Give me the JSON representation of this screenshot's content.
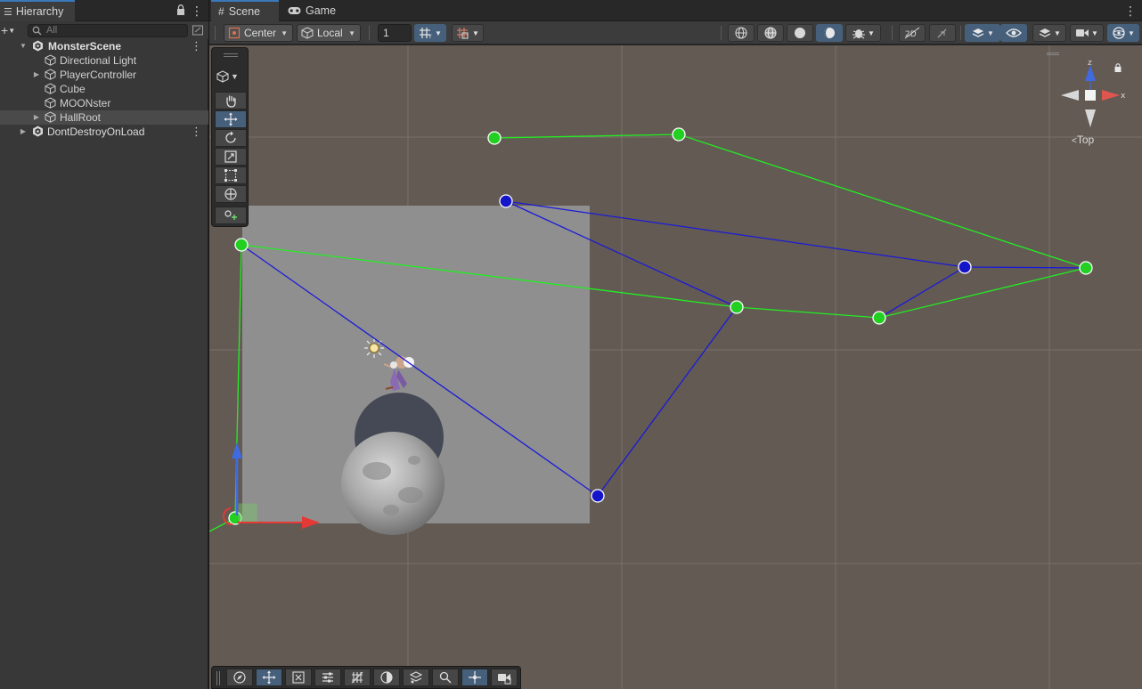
{
  "hierarchy": {
    "tab_label": "Hierarchy",
    "search_placeholder": "All",
    "items": [
      {
        "label": "MonsterScene",
        "kind": "scene",
        "expanded": true
      },
      {
        "label": "Directional Light",
        "kind": "gameobject"
      },
      {
        "label": "PlayerController",
        "kind": "gameobject",
        "has_children": true
      },
      {
        "label": "Cube",
        "kind": "gameobject"
      },
      {
        "label": "MOONster",
        "kind": "gameobject"
      },
      {
        "label": "HallRoot",
        "kind": "gameobject",
        "has_children": true,
        "selected": true
      },
      {
        "label": "DontDestroyOnLoad",
        "kind": "scene",
        "expanded": false
      }
    ]
  },
  "scene_view": {
    "tabs": [
      {
        "label": "Scene",
        "icon": "grid-icon",
        "active": true
      },
      {
        "label": "Game",
        "icon": "gamepad-icon",
        "active": false
      }
    ],
    "toolbar": {
      "pivot_mode": "Center",
      "pivot_rotation": "Local",
      "grid_snap_value": "1"
    },
    "orientation_label": "Top",
    "gizmo_axes": [
      "z",
      "x"
    ],
    "colors": {
      "viewport_bg": "#635a53",
      "green_path": "#22ee22",
      "blue_path": "#1a1ad8",
      "accent_blue": "#46607c",
      "axis_x": "#e53935",
      "axis_y": "#39c23c",
      "axis_z": "#3f6ae0"
    }
  }
}
